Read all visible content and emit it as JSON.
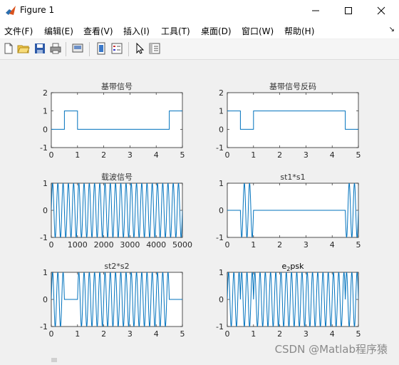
{
  "window": {
    "title": "Figure 1"
  },
  "menu": [
    {
      "label": "文件(F)"
    },
    {
      "label": "编辑(E)"
    },
    {
      "label": "查看(V)"
    },
    {
      "label": "插入(I)"
    },
    {
      "label": "工具(T)"
    },
    {
      "label": "桌面(D)"
    },
    {
      "label": "窗口(W)"
    },
    {
      "label": "帮助(H)"
    }
  ],
  "toolbar": {
    "buttons": [
      "new-figure-icon",
      "open-file-icon",
      "save-icon",
      "print-icon",
      "print-preview-icon",
      "link-plot-icon",
      "insert-legend-icon",
      "edit-plot-arrow-icon",
      "property-inspector-icon"
    ]
  },
  "watermark": "CSDN @Matlab程序猿",
  "colors": {
    "line": "#0072BD",
    "axes_bg": "#ffffff",
    "figure_bg": "#f0f0f0"
  },
  "chart_data": [
    {
      "type": "line",
      "title": "基带信号",
      "xlim": [
        0,
        5
      ],
      "ylim": [
        -1,
        2
      ],
      "xticks": [
        "0",
        "1",
        "2",
        "3",
        "4",
        "5"
      ],
      "yticks": [
        "-1",
        "0",
        "1",
        "2"
      ],
      "segments": [
        [
          0,
          0
        ],
        [
          0.5,
          0
        ],
        [
          0.5,
          1
        ],
        [
          1,
          1
        ],
        [
          1,
          0
        ],
        [
          4.5,
          0
        ],
        [
          4.5,
          1
        ],
        [
          5,
          1
        ]
      ]
    },
    {
      "type": "line",
      "title": "基带信号反码",
      "xlim": [
        0,
        5
      ],
      "ylim": [
        -1,
        2
      ],
      "xticks": [
        "0",
        "1",
        "2",
        "3",
        "4",
        "5"
      ],
      "yticks": [
        "-1",
        "0",
        "1",
        "2"
      ],
      "segments": [
        [
          0,
          1
        ],
        [
          0.5,
          1
        ],
        [
          0.5,
          0
        ],
        [
          1,
          0
        ],
        [
          1,
          1
        ],
        [
          4.5,
          1
        ],
        [
          4.5,
          0
        ],
        [
          5,
          0
        ]
      ]
    },
    {
      "type": "line",
      "title": "载波信号",
      "xlim": [
        0,
        5000
      ],
      "ylim": [
        -1,
        1
      ],
      "xticks": [
        "0",
        "1000",
        "2000",
        "3000",
        "4000",
        "5000"
      ],
      "yticks": [
        "-1",
        "0",
        "1"
      ],
      "cycles": 25
    },
    {
      "type": "line",
      "title": "st1*s1",
      "xlim": [
        0,
        5
      ],
      "ylim": [
        -1,
        1
      ],
      "xticks": [
        "0",
        "1",
        "2",
        "3",
        "4",
        "5"
      ],
      "yticks": [
        "-1",
        "0",
        "1"
      ],
      "cycles": 25,
      "active_intervals": [
        [
          0.5,
          1
        ],
        [
          4.5,
          5
        ]
      ]
    },
    {
      "type": "line",
      "title": "st2*s2",
      "xlim": [
        0,
        5
      ],
      "ylim": [
        -1,
        1
      ],
      "xticks": [
        "0",
        "1",
        "2",
        "3",
        "4",
        "5"
      ],
      "yticks": [
        "-1",
        "0",
        "1"
      ],
      "cycles": 25,
      "active_intervals": [
        [
          0,
          0.5
        ],
        [
          1,
          4.5
        ]
      ]
    },
    {
      "type": "line",
      "title": "e2psk",
      "title_main": "e",
      "title_sub": "2",
      "title_rest": "psk",
      "xlim": [
        0,
        5
      ],
      "ylim": [
        -1,
        1
      ],
      "xticks": [
        "0",
        "1",
        "2",
        "3",
        "4",
        "5"
      ],
      "yticks": [
        "-1",
        "0",
        "1"
      ],
      "cycles": 25,
      "inverted_intervals": [
        [
          0.5,
          1
        ],
        [
          4.5,
          5
        ]
      ]
    }
  ]
}
